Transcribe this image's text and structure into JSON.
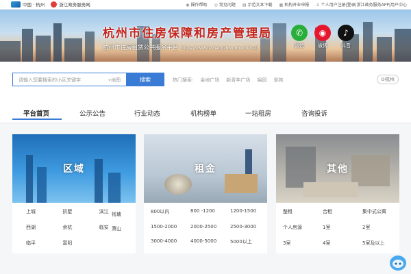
{
  "topbar": {
    "logo_text": "中国 · 杭州",
    "gov_text": "浙江政务服务网",
    "links": [
      "操作帮助",
      "常见问题",
      "示范文本下载",
      "机构开业申报",
      "个人用户注册|登录|浙江政务服务APP|用户中心"
    ]
  },
  "banner": {
    "title": "杭州市住房保障和房产管理局",
    "subtitle": "杭州市住房租赁公共服务平台",
    "url": "https://zwfw.hz.hangzhou.gov.cn/hzzl/",
    "social": [
      {
        "label": "微信",
        "icon": "wechat-icon",
        "color": "#2aae3a"
      },
      {
        "label": "微博",
        "icon": "weibo-icon",
        "color": "#e6162d"
      },
      {
        "label": "抖音",
        "icon": "douyin-icon",
        "color": "#111111"
      }
    ]
  },
  "search": {
    "placeholder": "请输入您要搜索的小区关键字",
    "map_label": "地图",
    "button": "搜索",
    "hot_label": "热门搜索:",
    "hot": [
      "金地广场",
      "新青年广场",
      "锦园",
      "翠苑"
    ],
    "city": "杭州"
  },
  "nav": {
    "items": [
      "平台首页",
      "公示公告",
      "行业动态",
      "机构榜单",
      "一站租房",
      "咨询投诉"
    ],
    "active": 0
  },
  "cards": [
    {
      "title": "区域",
      "items": [
        "上城",
        "拱墅",
        "滨江",
        "钱塘",
        "西湖",
        "余杭",
        "临安",
        "萧山",
        "临平",
        "富阳"
      ]
    },
    {
      "title": "租金",
      "items": [
        "800以内",
        "800 -1200",
        "1200-1500",
        "1500-2000",
        "2000-2500",
        "2500-3000",
        "3000-4000",
        "4000-5000",
        "5000以上"
      ]
    },
    {
      "title": "其他",
      "items": [
        "整租",
        "合租",
        "集中式公寓",
        "个人房源",
        "1室",
        "2室",
        "3室",
        "4室",
        "5室及以上"
      ]
    }
  ],
  "colors": {
    "accent": "#3a7bd5",
    "title_red": "#c2241b"
  }
}
